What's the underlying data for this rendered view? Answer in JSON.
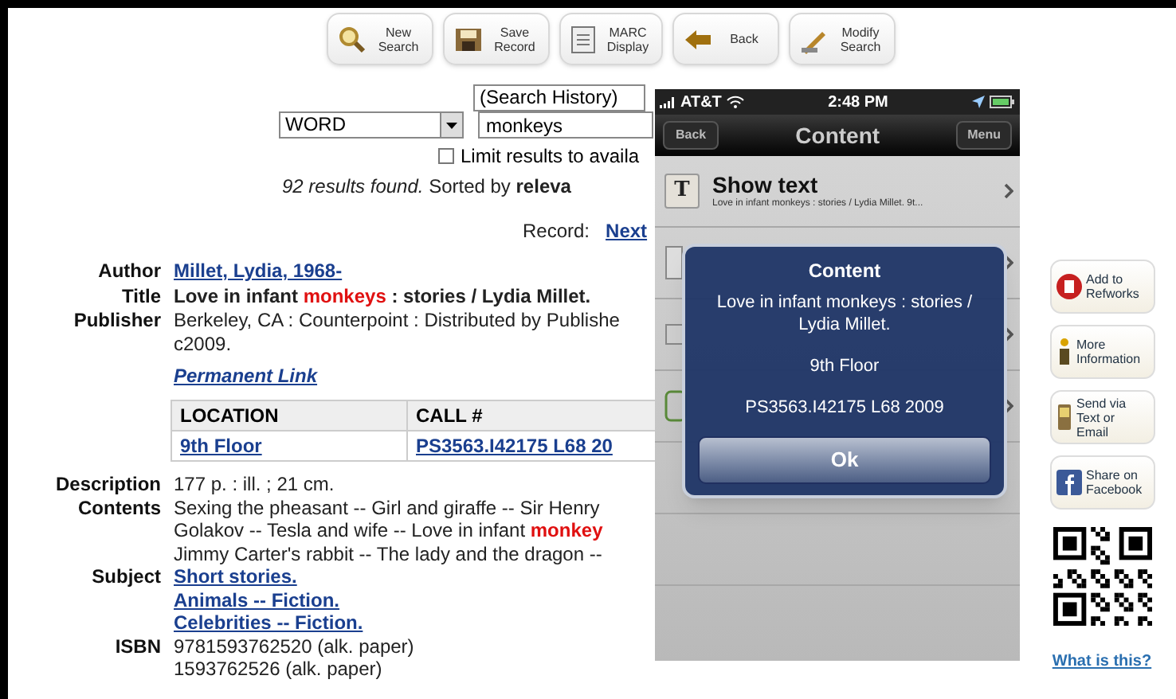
{
  "toolbar": [
    {
      "kind": "search",
      "label": "New Search"
    },
    {
      "kind": "save",
      "label": "Save Record"
    },
    {
      "kind": "marc",
      "label": "MARC Display"
    },
    {
      "kind": "back",
      "label": "Back"
    },
    {
      "kind": "modify",
      "label": "Modify Search"
    }
  ],
  "search": {
    "history": "(Search History)",
    "index": "WORD",
    "query": "monkeys",
    "limit": {
      "label": "Limit results to availa",
      "checked": false
    },
    "results": "*92 results found.* Sorted by **releva**",
    "record_label": "Record:",
    "next": "Next"
  },
  "record": [
    {
      "label": "Author",
      "kind": "links",
      "lines": [
        [
          {
            "text": "Millet, Lydia, 1968-"
          }
        ]
      ]
    },
    {
      "label": "Title",
      "kind": "bold",
      "lines": [
        [
          {
            "text": "Love in infant ",
            "highlight": false
          },
          {
            "text": "monkeys",
            "highlight": true
          },
          {
            "text": " : stories / Lydia Millet.",
            "highlight": false
          }
        ]
      ]
    },
    {
      "label": "Publisher",
      "kind": "text",
      "lines": [
        [
          {
            "text": "Berkeley, CA : Counterpoint : Distributed by Publishe"
          }
        ],
        [
          {
            "text": "c2009."
          }
        ]
      ]
    }
  ],
  "permanent_link": "Permanent Link",
  "holdings": {
    "columns": [
      "LOCATION",
      "CALL #"
    ],
    "rows": [
      [
        "9th Floor",
        "PS3563.I42175 L68 20"
      ]
    ]
  },
  "record2": [
    {
      "label": "Description",
      "kind": "text",
      "lines": [
        [
          {
            "text": "177 p. : ill. ; 21 cm."
          }
        ]
      ]
    },
    {
      "label": "Contents",
      "kind": "text",
      "lines": [
        [
          {
            "text": "Sexing the pheasant -- Girl and giraffe -- Sir Henry",
            "highlight": false
          }
        ],
        [
          {
            "text": "Golakov -- Tesla and wife -- Love in infant ",
            "highlight": false
          },
          {
            "text": "monkey",
            "highlight": true
          }
        ],
        [
          {
            "text": "Jimmy Carter's rabbit -- The lady and the dragon --",
            "highlight": false
          }
        ]
      ]
    },
    {
      "label": "Subject",
      "kind": "links",
      "lines": [
        [
          {
            "text": "Short stories."
          }
        ],
        [
          {
            "text": "Animals -- Fiction."
          }
        ],
        [
          {
            "text": "Celebrities -- Fiction."
          }
        ]
      ]
    },
    {
      "label": "ISBN",
      "kind": "text",
      "lines": [
        [
          {
            "text": "9781593762520 (alk. paper)"
          }
        ],
        [
          {
            "text": "1593762526 (alk. paper)"
          }
        ]
      ]
    }
  ],
  "side_buttons": [
    {
      "kind": "refworks",
      "label": "Add to Refworks"
    },
    {
      "kind": "info",
      "label": "More Information"
    },
    {
      "kind": "phone",
      "label": "Send via Text or Email"
    },
    {
      "kind": "facebook",
      "label": "Share on Facebook"
    }
  ],
  "qr_link": "What is this?",
  "phone": {
    "carrier": "AT&T",
    "time": "2:48 PM",
    "back": "Back",
    "title": "Content",
    "menu": "Menu",
    "rows": [
      {
        "kind": "text",
        "glyph": "T",
        "title": "Show text",
        "subtitle": "Love in infant monkeys : stories / Lydia Millet.  9t..."
      },
      {
        "kind": "copy"
      },
      {
        "kind": "send"
      },
      {
        "kind": "save"
      },
      {
        "kind": "empty"
      },
      {
        "kind": "empty"
      }
    ],
    "alert": {
      "title": "Content",
      "lines": [
        "Love in infant monkeys : stories / Lydia Millet.",
        "9th Floor",
        "PS3563.I42175 L68 2009"
      ],
      "button": "Ok"
    }
  }
}
